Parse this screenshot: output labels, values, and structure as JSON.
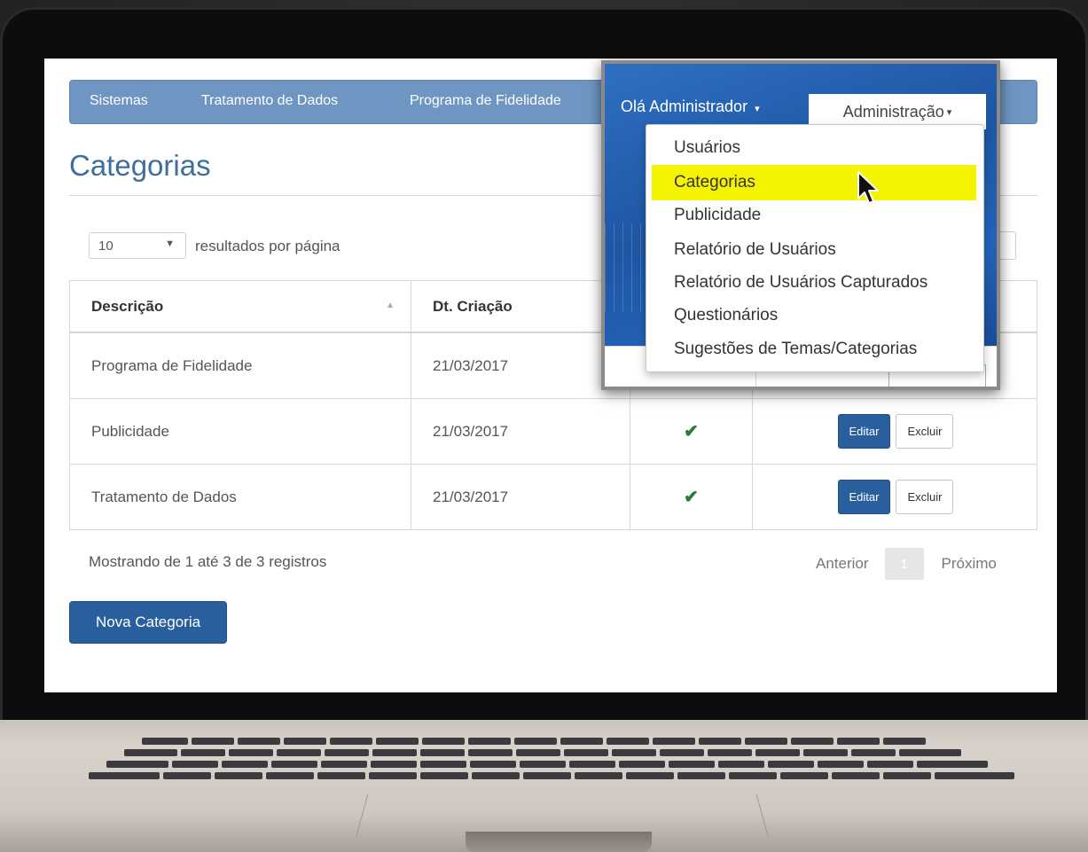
{
  "navbar": {
    "items": [
      "Sistemas",
      "Tratamento de Dados",
      "Programa de Fidelidade"
    ]
  },
  "page": {
    "title": "Categorias"
  },
  "length_menu": {
    "value": "10",
    "label": "resultados por página"
  },
  "table": {
    "headers": [
      "Descrição",
      "Dt. Criação"
    ],
    "rows": [
      {
        "descricao": "Programa de Fidelidade",
        "data": "21/03/2017"
      },
      {
        "descricao": "Publicidade",
        "data": "21/03/2017",
        "check": "✔",
        "edit": "Editar",
        "delete": "Excluir"
      },
      {
        "descricao": "Tratamento de Dados",
        "data": "21/03/2017",
        "check": "✔",
        "edit": "Editar",
        "delete": "Excluir"
      }
    ]
  },
  "info": "Mostrando de 1 até 3 de 3 registros",
  "pagination": {
    "prev": "Anterior",
    "current": "1",
    "next": "Próximo"
  },
  "new_button": "Nova Categoria",
  "user_menu": {
    "greeting": "Olá Administrador",
    "admin_label": "Administração"
  },
  "dropdown": {
    "items": [
      "Usuários",
      "Categorias",
      "Publicidade",
      "Relatório de Usuários",
      "Relatório de Usuários Capturados",
      "Questionários",
      "Sugestões de Temas/Categorias"
    ],
    "active_index": 1
  },
  "colors": {
    "navbar": "#6f96c2",
    "primary": "#2a5f9e",
    "highlight": "#f4f400",
    "title": "#3d6f9e"
  }
}
